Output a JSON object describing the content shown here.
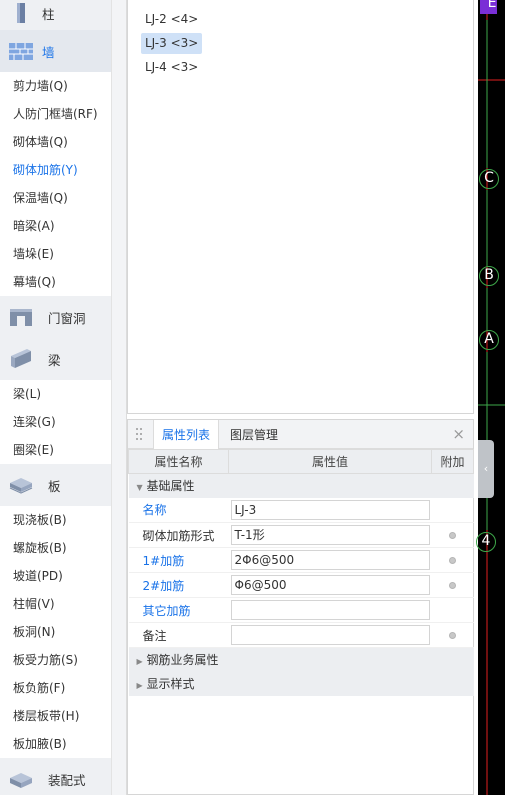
{
  "sidebar": {
    "groups": [
      {
        "label": "柱",
        "icon": "column-icon",
        "items": []
      },
      {
        "label": "墙",
        "icon": "wall-icon",
        "active": true,
        "items": [
          "剪力墙(Q)",
          "人防门框墙(RF)",
          "砌体墙(Q)",
          "砌体加筋(Y)",
          "保温墙(Q)",
          "暗梁(A)",
          "墙垛(E)",
          "幕墙(Q)"
        ]
      },
      {
        "label": "门窗洞",
        "icon": "door-window-icon",
        "items": []
      },
      {
        "label": "梁",
        "icon": "beam-icon",
        "items": [
          "梁(L)",
          "连梁(G)",
          "圈梁(E)"
        ]
      },
      {
        "label": "板",
        "icon": "slab-icon",
        "items": [
          "现浇板(B)",
          "螺旋板(B)",
          "坡道(PD)",
          "柱帽(V)",
          "板洞(N)",
          "板受力筋(S)",
          "板负筋(F)",
          "楼层板带(H)",
          "板加腋(B)"
        ]
      },
      {
        "label": "装配式",
        "icon": "prefab-icon",
        "items": []
      }
    ],
    "active_item": "砌体加筋(Y)"
  },
  "list": {
    "items": [
      "LJ-2 <4>",
      "LJ-3 <3>",
      "LJ-4 <3>"
    ],
    "selected": "LJ-3 <3>"
  },
  "props": {
    "tabs": [
      "属性列表",
      "图层管理"
    ],
    "active_tab": "属性列表",
    "headers": [
      "属性名称",
      "属性值",
      "附加"
    ],
    "group_basic": "基础属性",
    "rows": [
      {
        "name": "名称",
        "value": "LJ-3",
        "blue": true,
        "dot": false
      },
      {
        "name": "砌体加筋形式",
        "value": "T-1形",
        "blue": false,
        "dot": true
      },
      {
        "name": "1#加筋",
        "value": "2Φ6@500",
        "blue": true,
        "dot": true
      },
      {
        "name": "2#加筋",
        "value": "Φ6@500",
        "blue": true,
        "dot": true
      },
      {
        "name": "其它加筋",
        "value": "",
        "blue": true,
        "dot": false
      },
      {
        "name": "备注",
        "value": "",
        "blue": false,
        "dot": true
      }
    ],
    "group_rebar": "钢筋业务属性",
    "group_display": "显示样式"
  },
  "canvas": {
    "axis_labels": [
      "E",
      "C",
      "B",
      "A",
      "4"
    ],
    "colors": {
      "background": "#000000",
      "axis_line": "#e02020",
      "axis_circle": "#3ea84a",
      "top_marker": "#8a2be2"
    }
  },
  "colors": {
    "accent": "#1a73e8",
    "selected_row": "#cfe1f7"
  }
}
